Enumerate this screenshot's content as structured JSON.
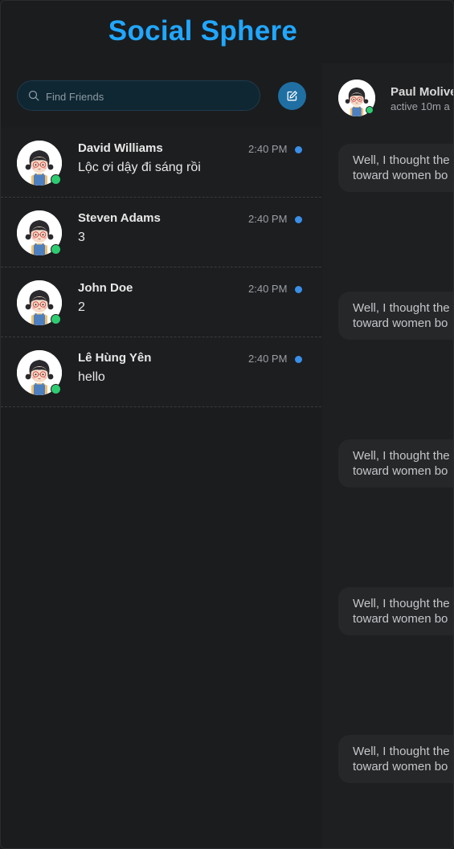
{
  "app": {
    "title": "Social Sphere"
  },
  "search": {
    "placeholder": "Find Friends"
  },
  "compose": {
    "icon": "edit-icon"
  },
  "conversations": [
    {
      "name": "David Williams",
      "last_message": "Lộc ơi dậy đi sáng rồi",
      "time": "2:40 PM",
      "online": true,
      "unread": true
    },
    {
      "name": "Steven Adams",
      "last_message": "3",
      "time": "2:40 PM",
      "online": true,
      "unread": true
    },
    {
      "name": "John Doe",
      "last_message": "2",
      "time": "2:40 PM",
      "online": true,
      "unread": true
    },
    {
      "name": "Lê Hùng Yên",
      "last_message": "hello",
      "time": "2:40 PM",
      "online": true,
      "unread": true
    }
  ],
  "chat": {
    "contact_name": "Paul Molive",
    "status": "active 10m a",
    "messages": [
      {
        "line1": "Well, I thought the",
        "line2": "toward women bo"
      },
      {
        "line1": "Well, I thought the",
        "line2": "toward women bo"
      },
      {
        "line1": "Well, I thought the",
        "line2": "toward women bo"
      },
      {
        "line1": "Well, I thought the",
        "line2": "toward women bo"
      },
      {
        "line1": "Well, I thought the",
        "line2": "toward women bo"
      }
    ]
  },
  "colors": {
    "brand": "#21a7ff",
    "online": "#2ecc71",
    "unread": "#3a8fe8",
    "compose_button": "#1f6fa3"
  }
}
